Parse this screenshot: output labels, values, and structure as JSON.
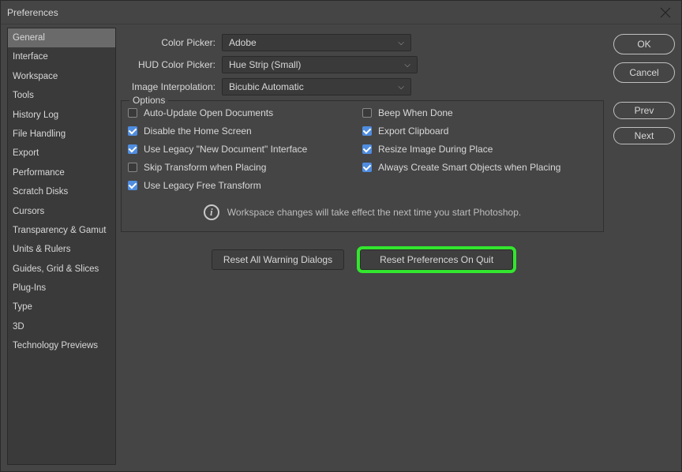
{
  "window": {
    "title": "Preferences"
  },
  "sidebar": {
    "items": [
      {
        "label": "General",
        "active": true
      },
      {
        "label": "Interface"
      },
      {
        "label": "Workspace"
      },
      {
        "label": "Tools"
      },
      {
        "label": "History Log"
      },
      {
        "label": "File Handling"
      },
      {
        "label": "Export"
      },
      {
        "label": "Performance"
      },
      {
        "label": "Scratch Disks"
      },
      {
        "label": "Cursors"
      },
      {
        "label": "Transparency & Gamut"
      },
      {
        "label": "Units & Rulers"
      },
      {
        "label": "Guides, Grid & Slices"
      },
      {
        "label": "Plug-Ins"
      },
      {
        "label": "Type"
      },
      {
        "label": "3D"
      },
      {
        "label": "Technology Previews"
      }
    ]
  },
  "form": {
    "colorPicker": {
      "label": "Color Picker:",
      "value": "Adobe"
    },
    "hudColorPicker": {
      "label": "HUD Color Picker:",
      "value": "Hue Strip (Small)"
    },
    "imageInterpolation": {
      "label": "Image Interpolation:",
      "value": "Bicubic Automatic"
    }
  },
  "options": {
    "title": "Options",
    "left": [
      {
        "label": "Auto-Update Open Documents",
        "checked": false
      },
      {
        "label": "Disable the Home Screen",
        "checked": true
      },
      {
        "label": "Use Legacy \"New Document\" Interface",
        "checked": true
      },
      {
        "label": "Skip Transform when Placing",
        "checked": false
      },
      {
        "label": "Use Legacy Free Transform",
        "checked": true
      }
    ],
    "right": [
      {
        "label": "Beep When Done",
        "checked": false
      },
      {
        "label": "Export Clipboard",
        "checked": true
      },
      {
        "label": "Resize Image During Place",
        "checked": true
      },
      {
        "label": "Always Create Smart Objects when Placing",
        "checked": true
      }
    ],
    "info": "Workspace changes will take effect the next time you start Photoshop."
  },
  "buttons": {
    "resetWarnings": "Reset All Warning Dialogs",
    "resetPrefs": "Reset Preferences On Quit"
  },
  "actions": {
    "ok": "OK",
    "cancel": "Cancel",
    "prev": "Prev",
    "next": "Next"
  }
}
